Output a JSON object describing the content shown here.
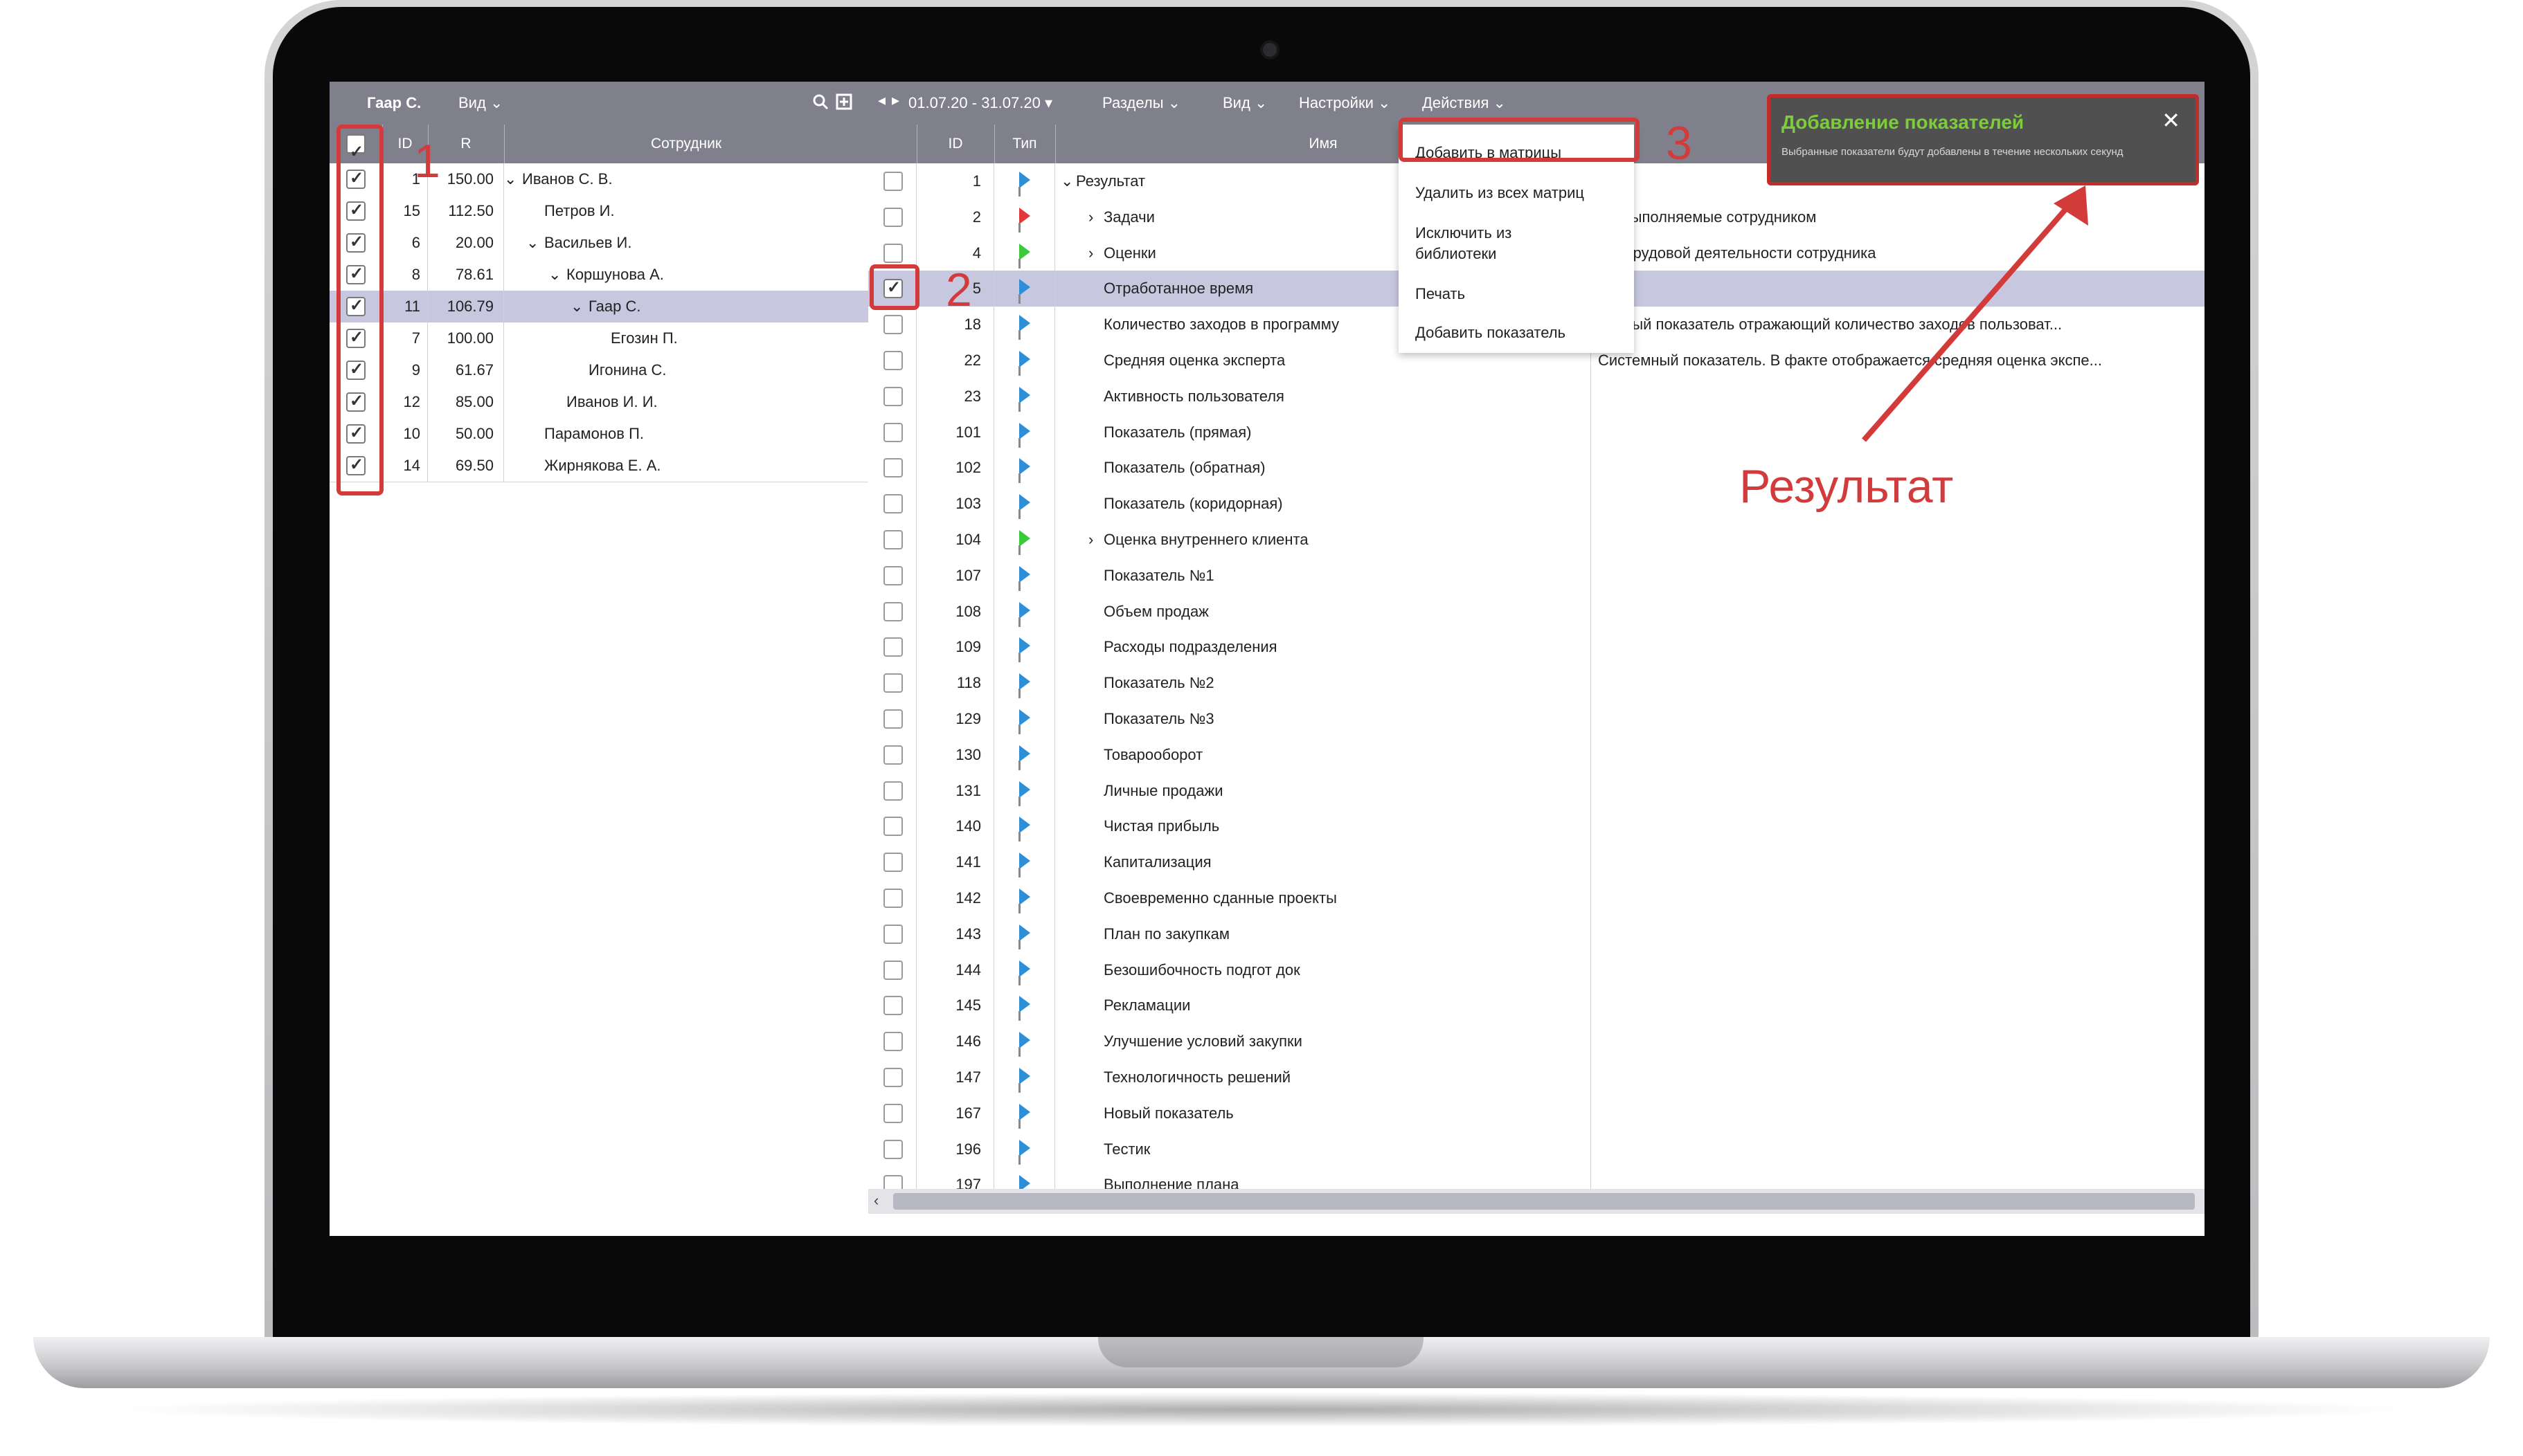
{
  "left_panel": {
    "user": "Гаар С.",
    "view_label": "Вид",
    "col_headers": {
      "id": "ID",
      "r": "R",
      "employee": "Сотрудник"
    },
    "rows": [
      {
        "id": "1",
        "r": "150.00",
        "name": "Иванов С. В.",
        "indent": 0,
        "exp": true,
        "sel": false
      },
      {
        "id": "15",
        "r": "112.50",
        "name": "Петров И.",
        "indent": 1,
        "exp": false,
        "sel": false
      },
      {
        "id": "6",
        "r": "20.00",
        "name": "Васильев И.",
        "indent": 1,
        "exp": true,
        "sel": false
      },
      {
        "id": "8",
        "r": "78.61",
        "name": "Коршунова А.",
        "indent": 2,
        "exp": true,
        "sel": false
      },
      {
        "id": "11",
        "r": "106.79",
        "name": "Гаар С.",
        "indent": 3,
        "exp": true,
        "sel": true
      },
      {
        "id": "7",
        "r": "100.00",
        "name": "Егозин П.",
        "indent": 4,
        "exp": false,
        "sel": false
      },
      {
        "id": "9",
        "r": "61.67",
        "name": "Игонина С.",
        "indent": 3,
        "exp": false,
        "sel": false
      },
      {
        "id": "12",
        "r": "85.00",
        "name": "Иванов И. И.",
        "indent": 2,
        "exp": false,
        "sel": false
      },
      {
        "id": "10",
        "r": "50.00",
        "name": "Парамонов П.",
        "indent": 1,
        "exp": false,
        "sel": false
      },
      {
        "id": "14",
        "r": "69.50",
        "name": "Жирнякова Е. А.",
        "indent": 1,
        "exp": false,
        "sel": false
      }
    ]
  },
  "right_panel": {
    "period": "01.07.20 - 31.07.20",
    "menus": [
      "Разделы",
      "Вид",
      "Настройки",
      "Действия"
    ],
    "col_headers": {
      "id": "ID",
      "type": "Тип",
      "name": "Имя"
    },
    "rows": [
      {
        "id": "1",
        "name": "Результат",
        "desc": "",
        "flag": "blue",
        "indent": 0,
        "exp": "down",
        "checked": false,
        "sel": false
      },
      {
        "id": "2",
        "name": "Задачи",
        "desc": "чи, выполняемые сотрудником",
        "flag": "red",
        "indent": 1,
        "exp": "right",
        "checked": false,
        "sel": false
      },
      {
        "id": "4",
        "name": "Оценки",
        "desc": "нка трудовой деятельности сотрудника",
        "flag": "green",
        "indent": 1,
        "exp": "right",
        "checked": false,
        "sel": false
      },
      {
        "id": "5",
        "name": "Отработанное время",
        "desc": "",
        "flag": "blue",
        "indent": 1,
        "exp": "",
        "checked": true,
        "sel": true
      },
      {
        "id": "18",
        "name": "Количество заходов в программу",
        "desc": "темный показатель отражающий количество заходов пользоват...",
        "flag": "blue",
        "indent": 1,
        "exp": "",
        "checked": false,
        "sel": false
      },
      {
        "id": "22",
        "name": "Средняя оценка эксперта",
        "desc": "Системный показатель. В факте отображается средняя оценка экспе...",
        "flag": "blue",
        "indent": 1,
        "exp": "",
        "checked": false,
        "sel": false
      },
      {
        "id": "23",
        "name": "Активность пользователя",
        "desc": "",
        "flag": "blue",
        "indent": 1,
        "exp": "",
        "checked": false,
        "sel": false
      },
      {
        "id": "101",
        "name": "Показатель (прямая)",
        "desc": "",
        "flag": "blue",
        "indent": 1,
        "exp": "",
        "checked": false,
        "sel": false
      },
      {
        "id": "102",
        "name": "Показатель (обратная)",
        "desc": "",
        "flag": "blue",
        "indent": 1,
        "exp": "",
        "checked": false,
        "sel": false
      },
      {
        "id": "103",
        "name": "Показатель (коридорная)",
        "desc": "",
        "flag": "blue",
        "indent": 1,
        "exp": "",
        "checked": false,
        "sel": false
      },
      {
        "id": "104",
        "name": "Оценка внутреннего клиента",
        "desc": "",
        "flag": "green",
        "indent": 1,
        "exp": "right",
        "checked": false,
        "sel": false
      },
      {
        "id": "107",
        "name": "Показатель №1",
        "desc": "",
        "flag": "blue",
        "indent": 1,
        "exp": "",
        "checked": false,
        "sel": false
      },
      {
        "id": "108",
        "name": "Объем продаж",
        "desc": "",
        "flag": "blue",
        "indent": 1,
        "exp": "",
        "checked": false,
        "sel": false
      },
      {
        "id": "109",
        "name": "Расходы подразделения",
        "desc": "",
        "flag": "blue",
        "indent": 1,
        "exp": "",
        "checked": false,
        "sel": false
      },
      {
        "id": "118",
        "name": "Показатель №2",
        "desc": "",
        "flag": "blue",
        "indent": 1,
        "exp": "",
        "checked": false,
        "sel": false
      },
      {
        "id": "129",
        "name": "Показатель №3",
        "desc": "",
        "flag": "blue",
        "indent": 1,
        "exp": "",
        "checked": false,
        "sel": false
      },
      {
        "id": "130",
        "name": "Товарооборот",
        "desc": "",
        "flag": "blue",
        "indent": 1,
        "exp": "",
        "checked": false,
        "sel": false
      },
      {
        "id": "131",
        "name": "Личные продажи",
        "desc": "",
        "flag": "blue",
        "indent": 1,
        "exp": "",
        "checked": false,
        "sel": false
      },
      {
        "id": "140",
        "name": "Чистая прибыль",
        "desc": "",
        "flag": "blue",
        "indent": 1,
        "exp": "",
        "checked": false,
        "sel": false
      },
      {
        "id": "141",
        "name": "Капитализация",
        "desc": "",
        "flag": "blue",
        "indent": 1,
        "exp": "",
        "checked": false,
        "sel": false
      },
      {
        "id": "142",
        "name": "Своевременно сданные проекты",
        "desc": "",
        "flag": "blue",
        "indent": 1,
        "exp": "",
        "checked": false,
        "sel": false
      },
      {
        "id": "143",
        "name": "План по закупкам",
        "desc": "",
        "flag": "blue",
        "indent": 1,
        "exp": "",
        "checked": false,
        "sel": false
      },
      {
        "id": "144",
        "name": "Безошибочность подгот док",
        "desc": "",
        "flag": "blue",
        "indent": 1,
        "exp": "",
        "checked": false,
        "sel": false
      },
      {
        "id": "145",
        "name": "Рекламации",
        "desc": "",
        "flag": "blue",
        "indent": 1,
        "exp": "",
        "checked": false,
        "sel": false
      },
      {
        "id": "146",
        "name": "Улучшение условий закупки",
        "desc": "",
        "flag": "blue",
        "indent": 1,
        "exp": "",
        "checked": false,
        "sel": false
      },
      {
        "id": "147",
        "name": "Технологичность решений",
        "desc": "",
        "flag": "blue",
        "indent": 1,
        "exp": "",
        "checked": false,
        "sel": false
      },
      {
        "id": "167",
        "name": "Новый показатель",
        "desc": "",
        "flag": "blue",
        "indent": 1,
        "exp": "",
        "checked": false,
        "sel": false
      },
      {
        "id": "196",
        "name": "Тестик",
        "desc": "",
        "flag": "blue",
        "indent": 1,
        "exp": "",
        "checked": false,
        "sel": false
      },
      {
        "id": "197",
        "name": "Выполнение плана",
        "desc": "",
        "flag": "blue",
        "indent": 1,
        "exp": "",
        "checked": false,
        "sel": false
      }
    ]
  },
  "actions_menu": [
    "Добавить в матрицы",
    "Удалить из всех матриц",
    "Исключить из библиотеки",
    "Печать",
    "Добавить показатель"
  ],
  "toast": {
    "title": "Добавление показателей",
    "message": "Выбранные показатели будут добавлены в течение нескольких секунд"
  },
  "annotations": {
    "n1": "1",
    "n2": "2",
    "n3": "3",
    "result": "Результат"
  },
  "colors": {
    "header_bg": "#80808c",
    "selected_row": "#c7c7df",
    "annotation": "#d33b3b",
    "toast_title": "#7ccd3a",
    "flag_blue": "#2f8fd6",
    "flag_red": "#e23a3a",
    "flag_green": "#3bc93b"
  }
}
